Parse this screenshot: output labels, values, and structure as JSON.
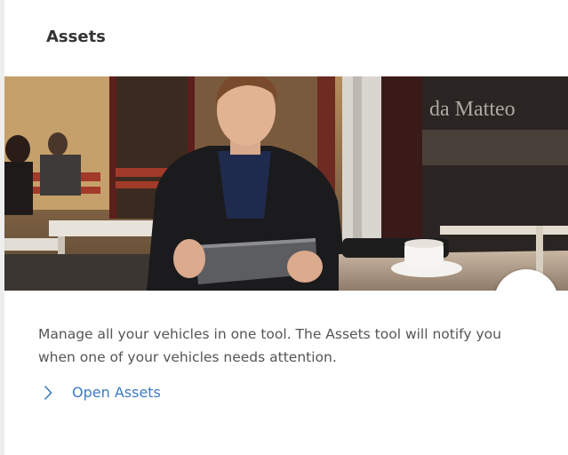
{
  "card": {
    "title": "Assets",
    "description": "Manage all your vehicles in one tool. The Assets tool will notify you when one of your vehicles needs attention.",
    "link_label": "Open Assets"
  },
  "hero": {
    "storefront_text": "da Matteo",
    "badge_icon": "vehicle-icon"
  },
  "colors": {
    "link": "#3c7bc4",
    "badge_icon": "#2d6fc0",
    "title": "#333333",
    "body_text": "#555555"
  }
}
